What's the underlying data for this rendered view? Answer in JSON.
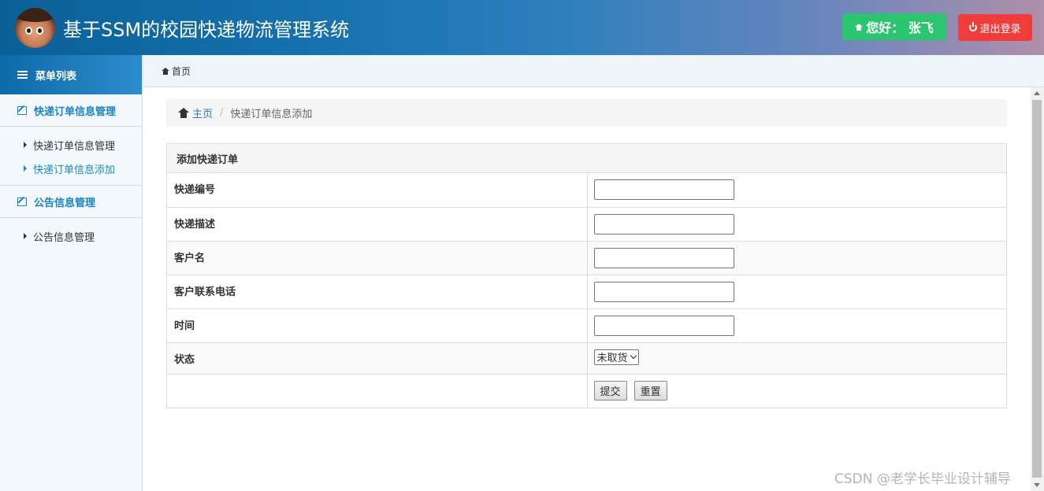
{
  "header": {
    "title": "基于SSM的校园快递物流管理系统",
    "greeting": "您好： 张飞",
    "logout_label": "退出登录"
  },
  "sidebar": {
    "menu_title": "菜单列表",
    "groups": [
      {
        "title": "快递订单信息管理",
        "items": [
          {
            "label": "快递订单信息管理",
            "active": false
          },
          {
            "label": "快递订单信息添加",
            "active": true
          }
        ]
      },
      {
        "title": "公告信息管理",
        "items": [
          {
            "label": "公告信息管理",
            "active": false
          }
        ]
      }
    ]
  },
  "tabbar": {
    "home_label": "首页"
  },
  "breadcrumb": {
    "home": "主页",
    "current": "快递订单信息添加"
  },
  "form": {
    "title": "添加快递订单",
    "fields": [
      {
        "label": "快递编号",
        "value": ""
      },
      {
        "label": "快递描述",
        "value": ""
      },
      {
        "label": "客户名",
        "value": ""
      },
      {
        "label": "客户联系电话",
        "value": ""
      },
      {
        "label": "时间",
        "value": ""
      }
    ],
    "status_label": "状态",
    "status_selected": "未取货",
    "submit_label": "提交",
    "reset_label": "重置"
  },
  "watermark": "CSDN @老学长毕业设计辅导",
  "colors": {
    "greet_bg": "#2cc56f",
    "logout_bg": "#f13c3c",
    "accent": "#1a82c4"
  }
}
